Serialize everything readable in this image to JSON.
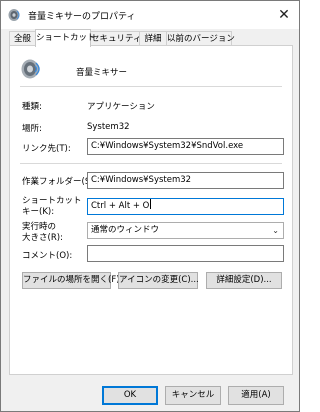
{
  "window": {
    "title": "音量ミキサーのプロパティ",
    "close_glyph": "✕"
  },
  "tabs": [
    "全般",
    "ショートカット",
    "セキュリティ",
    "詳細",
    "以前のバージョン"
  ],
  "app": {
    "name": "音量ミキサー",
    "icon": "speaker-icon"
  },
  "info": {
    "type_label": "種類:",
    "type_value": "アプリケーション",
    "location_label": "場所:",
    "location_value": "System32",
    "target_label": "リンク先(T):",
    "target_value": "C:¥Windows¥System32¥SndVol.exe"
  },
  "fields": {
    "workdir_label": "作業フォルダー(S):",
    "workdir_value": "C:¥Windows¥System32",
    "shortcut_label_line1": "ショートカット",
    "shortcut_label_line2": "キー(K):",
    "shortcut_value": "Ctrl + Alt + O",
    "run_label_line1": "実行時の",
    "run_label_line2": "大きさ(R):",
    "run_value": "通常のウィンドウ",
    "comment_label": "コメント(O):",
    "comment_value": ""
  },
  "actions": {
    "open_location": "ファイルの場所を開く(F)",
    "change_icon": "アイコンの変更(C)...",
    "advanced": "詳細設定(D)..."
  },
  "footer": {
    "ok": "OK",
    "cancel": "キャンセル",
    "apply": "適用(A)"
  },
  "colors": {
    "focus_accent": "#0078d7"
  }
}
